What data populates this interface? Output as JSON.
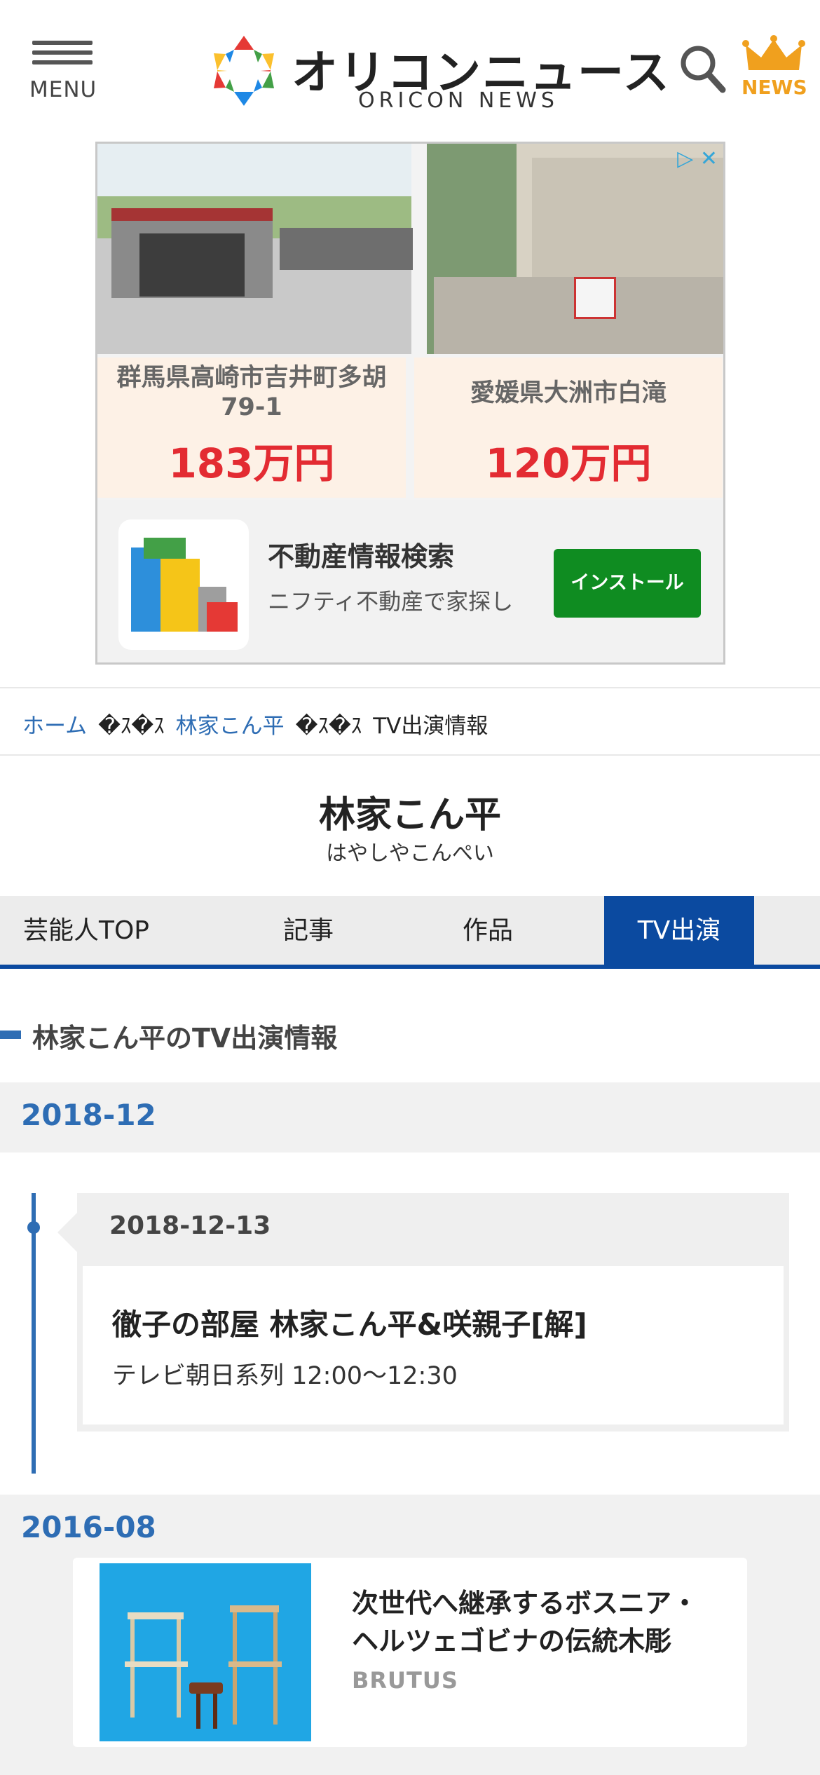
{
  "header": {
    "menu_label": "MENU",
    "logo_title": "オリコンニュース",
    "logo_subtitle": "ORICON NEWS",
    "news_label": "NEWS"
  },
  "ad": {
    "listings": [
      {
        "location": "群馬県高崎市吉井町多胡\n79-1",
        "price": "183万円"
      },
      {
        "location": "愛媛県大洲市白滝",
        "price": "120万円"
      }
    ],
    "app_title": "不動産情報検索",
    "app_description": "ニフティ不動産で家探し",
    "install_label": "インストール"
  },
  "breadcrumb": {
    "home": "ホーム",
    "separator": "�ｽ�ｽ",
    "artist": "林家こん平",
    "current": "TV出演情報"
  },
  "artist": {
    "name": "林家こん平",
    "kana": "はやしやこんぺい"
  },
  "tabs": [
    {
      "label": "芸能人TOP",
      "active": false
    },
    {
      "label": "記事",
      "active": false
    },
    {
      "label": "作品",
      "active": false
    },
    {
      "label": "TV出演",
      "active": true
    }
  ],
  "section_title": "林家こん平のTV出演情報",
  "months": [
    {
      "label": "2018-12",
      "entries": [
        {
          "date": "2018-12-13",
          "title": "徹子の部屋 林家こん平&咲親子[解]",
          "info": "テレビ朝日系列 12:00〜12:30"
        }
      ]
    },
    {
      "label": "2016-08"
    }
  ],
  "recommend": {
    "title": "次世代へ継承するボスニア・ヘルツェゴビナの伝統木彫",
    "source": "BRUTUS"
  },
  "colors": {
    "brand_blue": "#0b4aa0",
    "link_blue": "#2e6db4",
    "price_red": "#e32b32",
    "install_green": "#0f8c21",
    "crown_orange": "#f0a01e"
  }
}
